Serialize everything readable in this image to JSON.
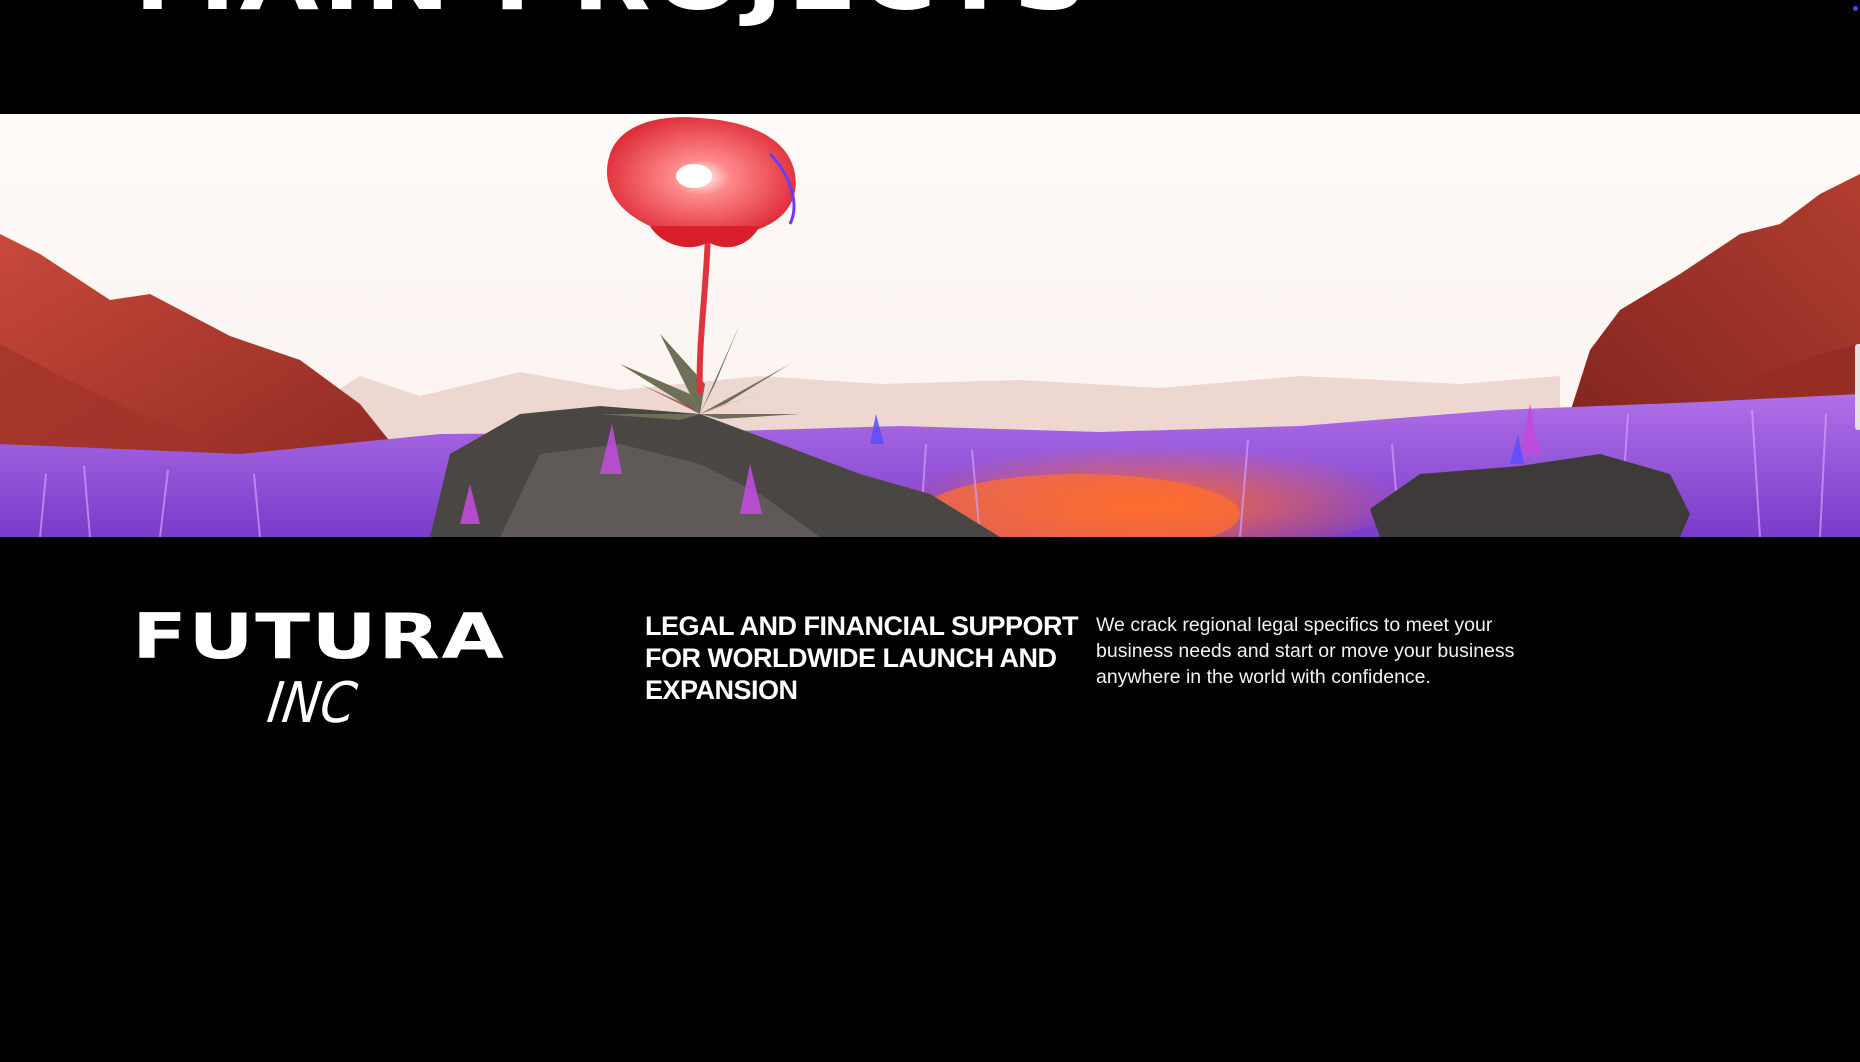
{
  "section": {
    "heading": "MAIN PROJECTS"
  },
  "project": {
    "brand": {
      "name": "FUTURA",
      "suffix": "INC"
    },
    "tagline": "LEGAL AND FINANCIAL SUPPORT FOR WORLDWIDE LAUNCH AND EXPANSION",
    "description": "We crack regional legal specifics to meet your business needs and start or move your business anywhere in the world with confidence."
  },
  "colors": {
    "background": "#000000",
    "text": "#ffffff",
    "accent_dot": "#3b4cff"
  }
}
